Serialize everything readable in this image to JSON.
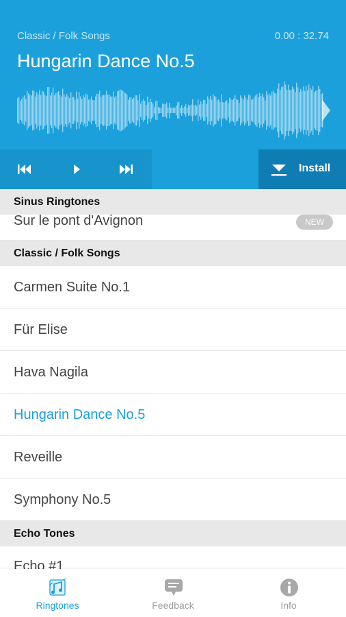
{
  "player": {
    "category": "Classic / Folk Songs",
    "timecode": "0.00 : 32.74",
    "title": "Hungarin Dance No.5",
    "accent_color": "#1ba0dc",
    "controls": {
      "prev_icon": "skip-previous-icon",
      "play_icon": "play-icon",
      "next_icon": "skip-next-icon",
      "install_icon": "download-icon",
      "install_label": "Install"
    }
  },
  "list": {
    "sections": [
      {
        "header": "Sinus Ringtones",
        "items": [
          {
            "label": "Sur le pont d'Avignon",
            "badge": "NEW"
          }
        ]
      },
      {
        "header": "Classic / Folk Songs",
        "items": [
          {
            "label": "Carmen Suite No.1"
          },
          {
            "label": "Für Elise"
          },
          {
            "label": "Hava Nagila"
          },
          {
            "label": "Hungarin Dance No.5",
            "active": true
          },
          {
            "label": "Reveille"
          },
          {
            "label": "Symphony No.5"
          }
        ]
      },
      {
        "header": "Echo Tones",
        "items": [
          {
            "label": "Echo #1"
          }
        ]
      }
    ]
  },
  "nav": {
    "items": [
      {
        "label": "Ringtones",
        "icon": "ringtones-icon",
        "active": true
      },
      {
        "label": "Feedback",
        "icon": "feedback-icon"
      },
      {
        "label": "Info",
        "icon": "info-icon"
      }
    ],
    "active_color": "#1a9fd9"
  }
}
